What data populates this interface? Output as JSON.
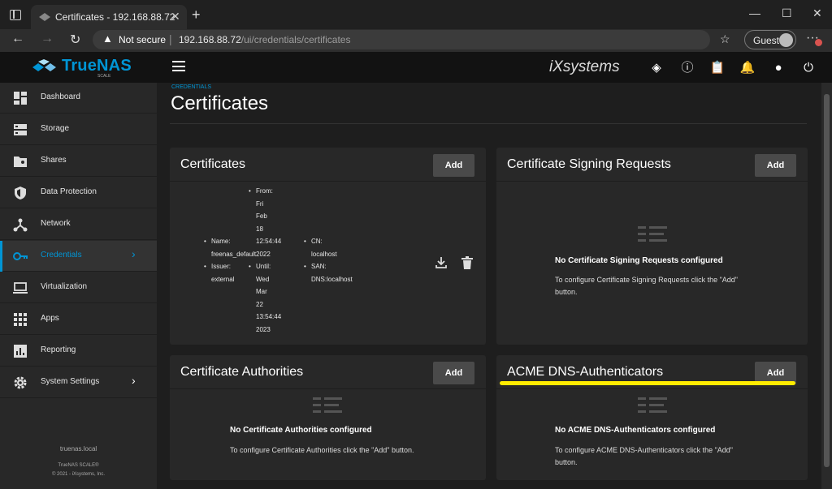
{
  "browser": {
    "tab_title": "Certificates - 192.168.88.72",
    "security_label": "Not secure",
    "url_host": "192.168.88.72",
    "url_path": "/ui/credentials/certificates",
    "profile_label": "Guest"
  },
  "topbar": {
    "brand": "TrueNAS",
    "brand_sub": "SCALE",
    "vendor": "iXsystems"
  },
  "sidebar": {
    "items": [
      {
        "label": "Dashboard",
        "icon": "dashboard-icon"
      },
      {
        "label": "Storage",
        "icon": "storage-icon"
      },
      {
        "label": "Shares",
        "icon": "shares-icon"
      },
      {
        "label": "Data Protection",
        "icon": "shield-icon"
      },
      {
        "label": "Network",
        "icon": "network-icon"
      },
      {
        "label": "Credentials",
        "icon": "key-icon",
        "active": true
      },
      {
        "label": "Virtualization",
        "icon": "laptop-icon"
      },
      {
        "label": "Apps",
        "icon": "apps-grid-icon"
      },
      {
        "label": "Reporting",
        "icon": "chart-icon"
      },
      {
        "label": "System Settings",
        "icon": "gear-icon"
      }
    ],
    "hostname": "truenas.local",
    "version": "TrueNAS SCALE®",
    "copyright": "© 2021 - iXsystems, Inc."
  },
  "page": {
    "breadcrumb": "CREDENTIALS",
    "title": "Certificates"
  },
  "cards": {
    "certificates": {
      "title": "Certificates",
      "add_label": "Add",
      "row": {
        "name_label": "Name:",
        "name_value": "freenas_default",
        "issuer_label": "Issuer:",
        "issuer_value": "external",
        "from_label": "From:",
        "from_value": [
          "Fri",
          "Feb",
          "18",
          "12:54:44",
          "2022"
        ],
        "until_label": "Until:",
        "until_value": [
          "Wed",
          "Mar",
          "22",
          "13:54:44",
          "2023"
        ],
        "cn_label": "CN:",
        "cn_value": "localhost",
        "san_label": "SAN:",
        "san_value": "DNS:localhost"
      }
    },
    "csr": {
      "title": "Certificate Signing Requests",
      "add_label": "Add",
      "empty_title": "No Certificate Signing Requests configured",
      "empty_desc": "To configure Certificate Signing Requests click the \"Add\" button."
    },
    "ca": {
      "title": "Certificate Authorities",
      "add_label": "Add",
      "empty_title": "No Certificate Authorities configured",
      "empty_desc": "To configure Certificate Authorities click the \"Add\" button."
    },
    "acme": {
      "title": "ACME DNS-Authenticators",
      "add_label": "Add",
      "empty_title": "No ACME DNS-Authenticators configured",
      "empty_desc": "To configure ACME DNS-Authenticators click the \"Add\" button."
    }
  },
  "colors": {
    "accent": "#0095d5",
    "highlight": "#ffeb00",
    "card_bg": "#282828",
    "sidebar_bg": "#282828"
  }
}
